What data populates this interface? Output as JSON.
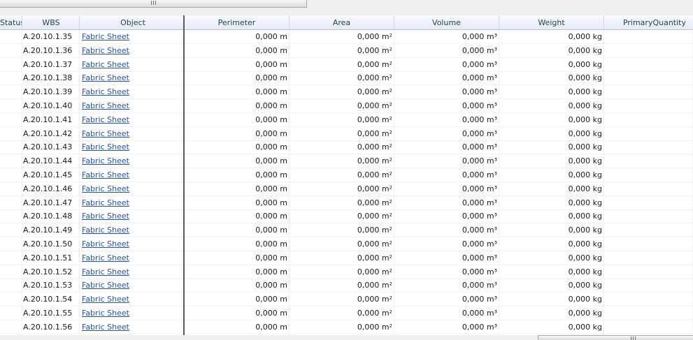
{
  "columns": {
    "status": "Status",
    "wbs": "WBS",
    "object": "Object",
    "perimeter": "Perimeter",
    "area": "Area",
    "volume": "Volume",
    "weight": "Weight",
    "primary_quantity": "PrimaryQuantity"
  },
  "rows": [
    {
      "wbs": "A.20.10.1.35",
      "object": "Fabric Sheet",
      "perimeter": "0,000 m",
      "area": "0,000 m²",
      "volume": "0,000 m³",
      "weight": "0,000 kg"
    },
    {
      "wbs": "A.20.10.1.36",
      "object": "Fabric Sheet",
      "perimeter": "0,000 m",
      "area": "0,000 m²",
      "volume": "0,000 m³",
      "weight": "0,000 kg"
    },
    {
      "wbs": "A.20.10.1.37",
      "object": "Fabric Sheet",
      "perimeter": "0,000 m",
      "area": "0,000 m²",
      "volume": "0,000 m³",
      "weight": "0,000 kg"
    },
    {
      "wbs": "A.20.10.1.38",
      "object": "Fabric Sheet",
      "perimeter": "0,000 m",
      "area": "0,000 m²",
      "volume": "0,000 m³",
      "weight": "0,000 kg"
    },
    {
      "wbs": "A.20.10.1.39",
      "object": "Fabric Sheet",
      "perimeter": "0,000 m",
      "area": "0,000 m²",
      "volume": "0,000 m³",
      "weight": "0,000 kg"
    },
    {
      "wbs": "A.20.10.1.40",
      "object": "Fabric Sheet",
      "perimeter": "0,000 m",
      "area": "0,000 m²",
      "volume": "0,000 m³",
      "weight": "0,000 kg"
    },
    {
      "wbs": "A.20.10.1.41",
      "object": "Fabric Sheet",
      "perimeter": "0,000 m",
      "area": "0,000 m²",
      "volume": "0,000 m³",
      "weight": "0,000 kg"
    },
    {
      "wbs": "A.20.10.1.42",
      "object": "Fabric Sheet",
      "perimeter": "0,000 m",
      "area": "0,000 m²",
      "volume": "0,000 m³",
      "weight": "0,000 kg"
    },
    {
      "wbs": "A.20.10.1.43",
      "object": "Fabric Sheet",
      "perimeter": "0,000 m",
      "area": "0,000 m²",
      "volume": "0,000 m³",
      "weight": "0,000 kg"
    },
    {
      "wbs": "A.20.10.1.44",
      "object": "Fabric Sheet",
      "perimeter": "0,000 m",
      "area": "0,000 m²",
      "volume": "0,000 m³",
      "weight": "0,000 kg"
    },
    {
      "wbs": "A.20.10.1.45",
      "object": "Fabric Sheet",
      "perimeter": "0,000 m",
      "area": "0,000 m²",
      "volume": "0,000 m³",
      "weight": "0,000 kg"
    },
    {
      "wbs": "A.20.10.1.46",
      "object": "Fabric Sheet",
      "perimeter": "0,000 m",
      "area": "0,000 m²",
      "volume": "0,000 m³",
      "weight": "0,000 kg"
    },
    {
      "wbs": "A.20.10.1.47",
      "object": "Fabric Sheet",
      "perimeter": "0,000 m",
      "area": "0,000 m²",
      "volume": "0,000 m³",
      "weight": "0,000 kg"
    },
    {
      "wbs": "A.20.10.1.48",
      "object": "Fabric Sheet",
      "perimeter": "0,000 m",
      "area": "0,000 m²",
      "volume": "0,000 m³",
      "weight": "0,000 kg"
    },
    {
      "wbs": "A.20.10.1.49",
      "object": "Fabric Sheet",
      "perimeter": "0,000 m",
      "area": "0,000 m²",
      "volume": "0,000 m³",
      "weight": "0,000 kg"
    },
    {
      "wbs": "A.20.10.1.50",
      "object": "Fabric Sheet",
      "perimeter": "0,000 m",
      "area": "0,000 m²",
      "volume": "0,000 m³",
      "weight": "0,000 kg"
    },
    {
      "wbs": "A.20.10.1.51",
      "object": "Fabric Sheet",
      "perimeter": "0,000 m",
      "area": "0,000 m²",
      "volume": "0,000 m³",
      "weight": "0,000 kg"
    },
    {
      "wbs": "A.20.10.1.52",
      "object": "Fabric Sheet",
      "perimeter": "0,000 m",
      "area": "0,000 m²",
      "volume": "0,000 m³",
      "weight": "0,000 kg"
    },
    {
      "wbs": "A.20.10.1.53",
      "object": "Fabric Sheet",
      "perimeter": "0,000 m",
      "area": "0,000 m²",
      "volume": "0,000 m³",
      "weight": "0,000 kg"
    },
    {
      "wbs": "A.20.10.1.54",
      "object": "Fabric Sheet",
      "perimeter": "0,000 m",
      "area": "0,000 m²",
      "volume": "0,000 m³",
      "weight": "0,000 kg"
    },
    {
      "wbs": "A.20.10.1.55",
      "object": "Fabric Sheet",
      "perimeter": "0,000 m",
      "area": "0,000 m²",
      "volume": "0,000 m³",
      "weight": "0,000 kg"
    },
    {
      "wbs": "A.20.10.1.56",
      "object": "Fabric Sheet",
      "perimeter": "0,000 m",
      "area": "0,000 m²",
      "volume": "0,000 m³",
      "weight": "0,000 kg"
    }
  ],
  "colors": {
    "header_bg": "#e4ebf5",
    "header_text": "#2a3b55",
    "link": "#1f52c3"
  }
}
